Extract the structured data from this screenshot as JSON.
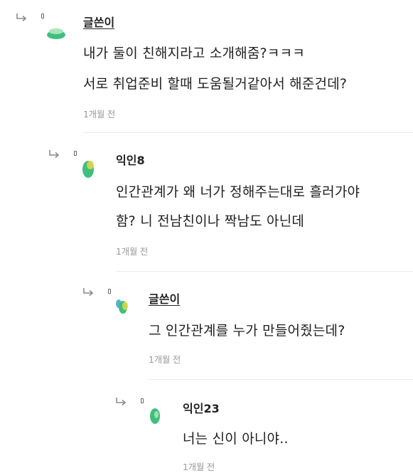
{
  "comments": [
    {
      "author": "글쓴이",
      "is_op": true,
      "lines": [
        "내가 둘이 친해지라고 소개해줌?ㅋㅋㅋ",
        "서로 취업준비 할때 도움될거같아서 해준건데?"
      ],
      "time": "1개월 전"
    },
    {
      "author": "익인8",
      "is_op": false,
      "lines": [
        "인간관계가 왜 너가 정해주는대로 흘러가야",
        "함? 니 전남친이나 짝남도 아닌데"
      ],
      "time": "1개월 전"
    },
    {
      "author": "글쓴이",
      "is_op": true,
      "lines": [
        "그 인간관계를 누가 만들어줬는데?"
      ],
      "time": "1개월 전"
    },
    {
      "author": "익인23",
      "is_op": false,
      "lines": [
        "너는 신이 아니야.."
      ],
      "time": "1개월 전"
    }
  ],
  "icons": {
    "reply_arrow": "reply-arrow-icon",
    "avatar": "avatar-icon"
  },
  "colors": {
    "avatar_green": "#3fbf7f",
    "avatar_light_green": "#a8e6b8",
    "avatar_blue": "#5ab0d8",
    "avatar_yellow": "#e6d64a",
    "timestamp_gray": "#9a9a9a",
    "divider": "#ececec"
  }
}
